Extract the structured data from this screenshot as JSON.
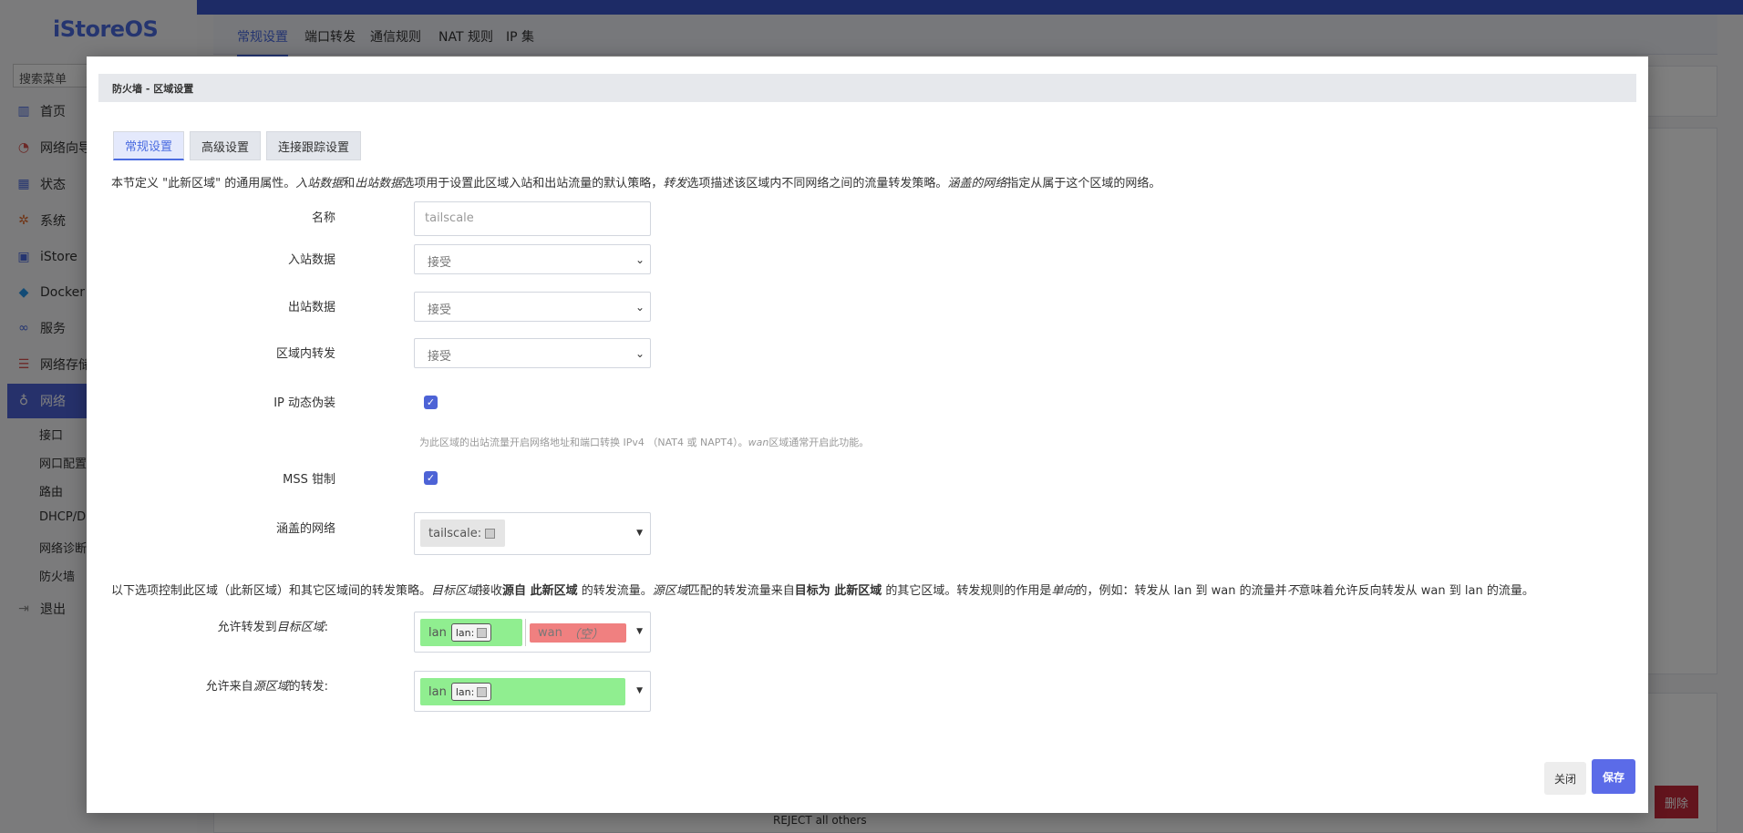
{
  "sidebar": {
    "brand": "iStoreOS",
    "search_placeholder": "搜索菜单",
    "items": [
      {
        "label": "首页",
        "icon": "chart-icon"
      },
      {
        "label": "网络向导",
        "icon": "globe-icon"
      },
      {
        "label": "状态",
        "icon": "grid-icon"
      },
      {
        "label": "系统",
        "icon": "gear-icon"
      },
      {
        "label": "iStore",
        "icon": "store-icon"
      },
      {
        "label": "Docker",
        "icon": "docker-icon"
      },
      {
        "label": "服务",
        "icon": "link-icon"
      },
      {
        "label": "网络存储",
        "icon": "storage-icon"
      },
      {
        "label": "网络",
        "icon": "network-icon"
      }
    ],
    "subitems": [
      "接口",
      "网口配置",
      "路由",
      "DHCP/DNS",
      "网络诊断",
      "防火墙"
    ],
    "logout": "退出"
  },
  "page_tabs": [
    "常规设置",
    "端口转发",
    "通信规则",
    "NAT 规则",
    "IP 集"
  ],
  "bg_footer_text": "REJECT all others",
  "bg_delete": "删除",
  "modal": {
    "title": "防火墙 - 区域设置",
    "tabs": [
      "常规设置",
      "高级设置",
      "连接跟踪设置"
    ],
    "desc1": {
      "p1": "本节定义 \"此新区域\" 的通用属性。",
      "i1": "入站数据",
      "p2": "和",
      "i2": "出站数据",
      "p3": "选项用于设置此区域入站和出站流量的默认策略，",
      "i3": "转发",
      "p4": "选项描述该区域内不同网络之间的流量转发策略。",
      "i4": "涵盖的网络",
      "p5": "指定从属于这个区域的网络。"
    },
    "name": {
      "label": "名称",
      "placeholder": "tailscale"
    },
    "input": {
      "label": "入站数据",
      "value": "接受"
    },
    "output": {
      "label": "出站数据",
      "value": "接受"
    },
    "forward": {
      "label": "区域内转发",
      "value": "接受"
    },
    "masq": {
      "label": "IP 动态伪装",
      "hint_p1": "为此区域的出站流量开启网络地址和端口转换 IPv4 （NAT4 或 NAPT4）。",
      "hint_i": "wan",
      "hint_p2": "区域通常开启此功能。"
    },
    "mss": {
      "label": "MSS 钳制"
    },
    "networks": {
      "label": "涵盖的网络",
      "chip": "tailscale:"
    },
    "desc2": {
      "p1": "以下选项控制此区域（此新区域）和其它区域间的转发策略。",
      "i1": "目标区域",
      "p2": "接收",
      "b1": "源自 此新区域",
      "p3": " 的转发流量。",
      "i2": "源区域",
      "p4": "匹配的转发流量来自",
      "b2": "目标为 此新区域",
      "p5": " 的其它区域。转发规则的作用是",
      "i3": "单向",
      "p6": "的，例如：转发从 lan 到 wan 的流量并",
      "i4": "不",
      "p7": "意味着允许反向转发从 wan 到 lan 的流量。"
    },
    "dest": {
      "label_p1": "允许转发到",
      "label_i": "目标区域",
      "label_p2": ":",
      "chip1": "lan",
      "chip1_tag": "lan:",
      "chip2": "wan",
      "chip2_note": "（空）"
    },
    "src": {
      "label_p1": "允许来自",
      "label_i": "源区域",
      "label_p2": "的转发:",
      "chip1": "lan",
      "chip1_tag": "lan:"
    },
    "buttons": {
      "close": "关闭",
      "save": "保存"
    }
  }
}
